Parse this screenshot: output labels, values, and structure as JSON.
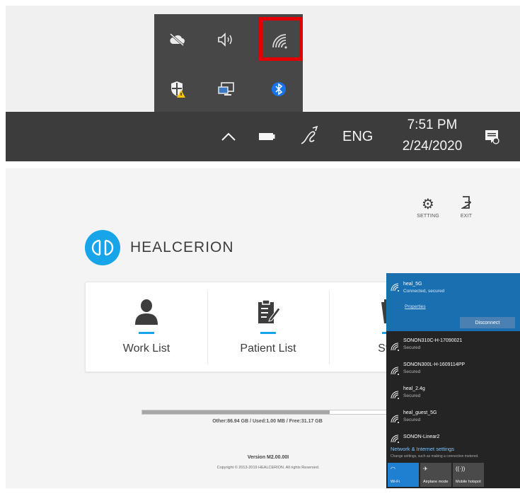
{
  "tray": {
    "icons": [
      "cloud-offline-icon",
      "speaker-icon",
      "wifi-icon",
      "security-shield-warning-icon",
      "display-icon",
      "bluetooth-icon"
    ],
    "highlight_color": "#e30000"
  },
  "taskbar": {
    "language": "ENG",
    "time": "7:51 PM",
    "date": "2/24/2020"
  },
  "app": {
    "brand_name": "HEALCERION",
    "accent_color": "#17a4e8",
    "top_actions": [
      {
        "label": "SETTING",
        "icon": "gear-icon"
      },
      {
        "label": "EXIT",
        "icon": "exit-icon"
      }
    ],
    "menu": [
      {
        "label": "Work List",
        "icon": "person-icon"
      },
      {
        "label": "Patient List",
        "icon": "clipboard-icon"
      },
      {
        "label": "Start",
        "icon": "scanner-icon"
      }
    ],
    "storage": {
      "text": "Other:86.94 GB / Used:1.00 MB / Free:31.17 GB",
      "used_fraction": 0.74
    },
    "version": "Version M2.00.00I",
    "copyright": "Copyright © 2013-2019 HEALCERION. All rights Reserved."
  },
  "wifi_panel": {
    "connected": {
      "name": "heal_5G",
      "status": "Connected, secured",
      "properties_label": "Properties",
      "disconnect_label": "Disconnect"
    },
    "networks": [
      {
        "name": "SONON310C-H-17090021",
        "status": "Secured"
      },
      {
        "name": "SONON300L-H-1609114PP",
        "status": "Secured"
      },
      {
        "name": "heal_2.4g",
        "status": "Secured"
      },
      {
        "name": "heal_guest_5G",
        "status": "Secured"
      },
      {
        "name": "SONON-Linear2",
        "status": ""
      }
    ],
    "settings_title": "Network & Internet settings",
    "settings_sub": "Change settings, such as making a connection metered.",
    "quick_actions": [
      {
        "label": "Wi-Fi",
        "active": true
      },
      {
        "label": "Airplane mode",
        "active": false
      },
      {
        "label": "Mobile hotspot",
        "active": false
      }
    ]
  }
}
